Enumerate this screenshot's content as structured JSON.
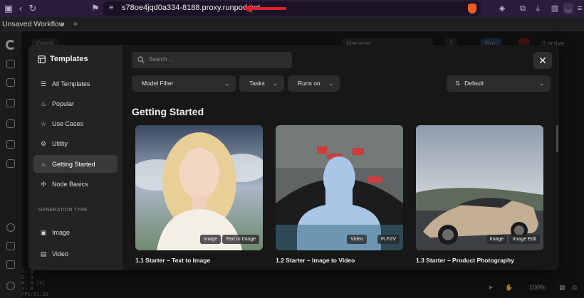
{
  "browser": {
    "url": "s78oe4jqd0a334-8188.proxy.runpod.net"
  },
  "app": {
    "tab_title": "Unsaved Workflow",
    "new_tab": "+",
    "bg_graph": "Graph",
    "bg_manager": "Manager",
    "bg_run": "Run",
    "bg_queue_count": "1",
    "bg_active": "0 active",
    "zoom": "100%",
    "status_lines": [
      "T: 0",
      "I: 0",
      "N: 0 [0]",
      "V: 0",
      "FPS:61.28"
    ]
  },
  "modal": {
    "title": "Templates",
    "nav": [
      {
        "label": "All Templates",
        "icon": "list-icon"
      },
      {
        "label": "Popular",
        "icon": "flame-icon"
      },
      {
        "label": "Use Cases",
        "icon": "star-icon"
      },
      {
        "label": "Utility",
        "icon": "gear-icon"
      },
      {
        "label": "Getting Started",
        "icon": "graduation-cap-icon",
        "active": true
      },
      {
        "label": "Node Basics",
        "icon": "nodes-icon"
      }
    ],
    "section_label": "GENERATION TYPE",
    "gen_types": [
      {
        "label": "Image",
        "icon": "image-icon"
      },
      {
        "label": "Video",
        "icon": "film-icon"
      }
    ],
    "search_placeholder": "Search ...",
    "filters": {
      "model": "Model Filter",
      "tasks": "Tasks",
      "runs_on": "Runs on",
      "sort": "Default"
    },
    "heading": "Getting Started",
    "cards": [
      {
        "title": "1.1 Starter – Text to Image",
        "tags": [
          "Image",
          "Text to Image"
        ]
      },
      {
        "title": "1.2 Starter – Image to Video",
        "tags": [
          "Video",
          "FLF2V"
        ]
      },
      {
        "title": "1.3 Starter – Product Photography",
        "tags": [
          "Image",
          "Image Edit"
        ]
      }
    ]
  },
  "colors": {
    "chrome": "#2b1d3a",
    "annotation_arrow": "#e0202a",
    "active_nav": "#3a3a3a"
  }
}
